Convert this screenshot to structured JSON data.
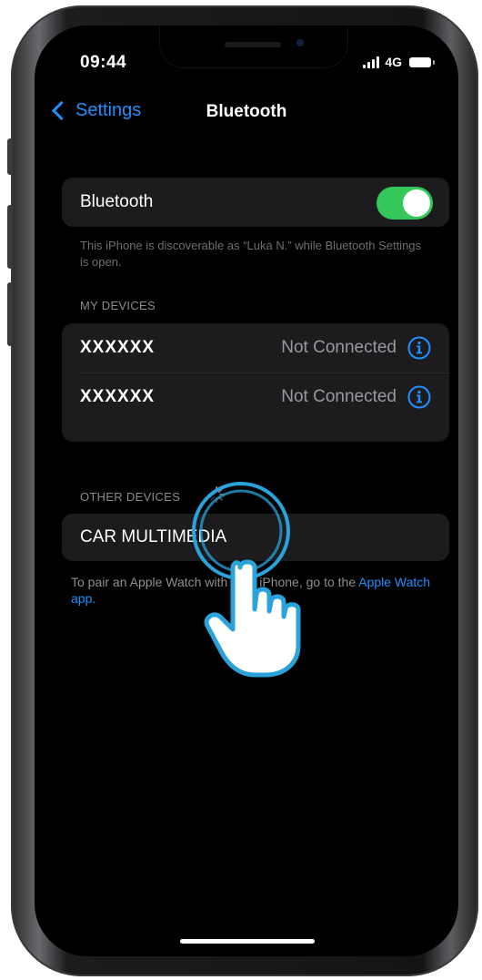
{
  "status_bar": {
    "time": "09:44",
    "network": "4G"
  },
  "nav": {
    "back_label": "Settings",
    "title": "Bluetooth"
  },
  "bluetooth": {
    "label": "Bluetooth",
    "enabled": true,
    "footnote": "This iPhone is discoverable as “Luka N.” while Bluetooth Settings is open."
  },
  "my_devices": {
    "header": "MY DEVICES",
    "items": [
      {
        "name": "XXXXXX",
        "status": "Not Connected"
      },
      {
        "name": "XXXXXX",
        "status": "Not Connected"
      }
    ]
  },
  "other_devices": {
    "header": "OTHER DEVICES",
    "items": [
      {
        "name": "CAR MULTIMEDIA"
      }
    ],
    "footer_text": "To pair an Apple Watch with your iPhone, go to the ",
    "footer_link": "Apple Watch app."
  },
  "colors": {
    "accent": "#1e90ff",
    "toggle_on": "#34c759",
    "background": "#000000",
    "cell": "#1c1c1e",
    "tap_highlight": "#29a3d9"
  },
  "icons": [
    "chevron-left-icon",
    "signal-icon",
    "battery-icon",
    "info-icon",
    "spinner-icon",
    "tap-hand-icon"
  ]
}
